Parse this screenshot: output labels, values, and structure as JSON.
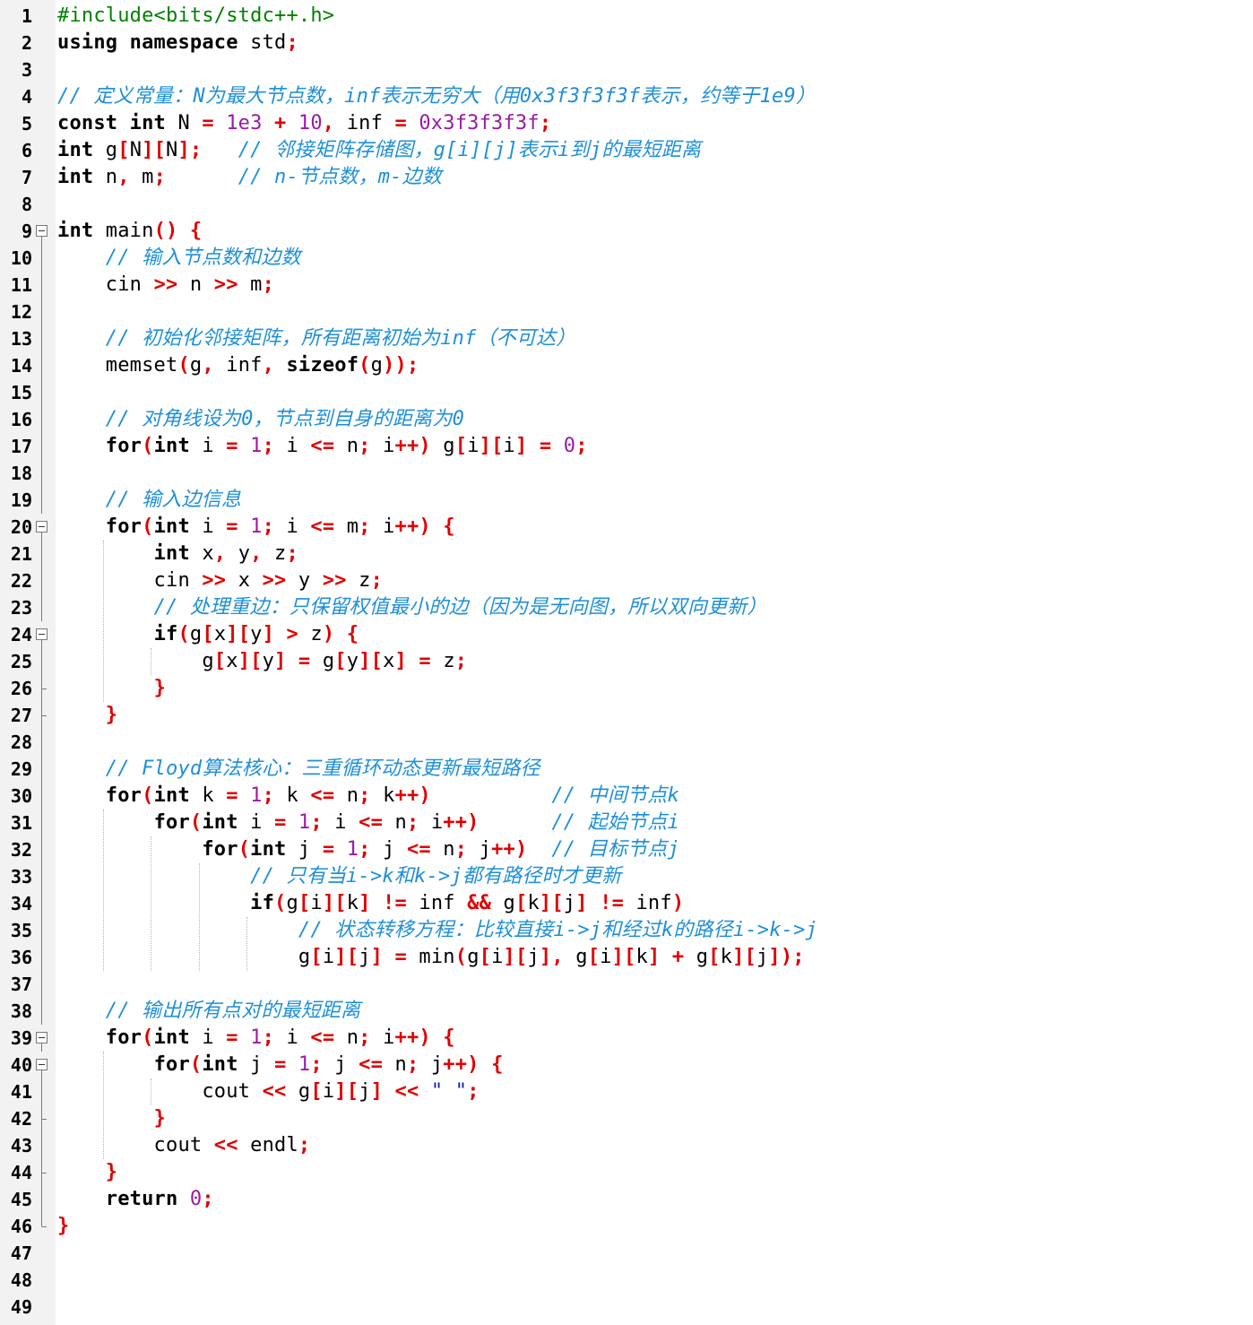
{
  "editor": {
    "line_numbers": [
      "1",
      "2",
      "3",
      "4",
      "5",
      "6",
      "7",
      "8",
      "9",
      "10",
      "11",
      "12",
      "13",
      "14",
      "15",
      "16",
      "17",
      "18",
      "19",
      "20",
      "21",
      "22",
      "23",
      "24",
      "25",
      "26",
      "27",
      "28",
      "29",
      "30",
      "31",
      "32",
      "33",
      "34",
      "35",
      "36",
      "37",
      "38",
      "39",
      "40",
      "41",
      "42",
      "43",
      "44",
      "45",
      "46",
      "47",
      "48",
      "49"
    ],
    "lines": [
      [
        [
          "pp",
          "#include<bits/stdc++.h>"
        ]
      ],
      [
        [
          "kw",
          "using namespace "
        ],
        [
          "id",
          "std"
        ],
        [
          "op",
          ";"
        ]
      ],
      [],
      [
        [
          "cm",
          "// 定义常量：N为最大节点数，inf表示无穷大（用0x3f3f3f3f表示，约等于1e9）"
        ]
      ],
      [
        [
          "kw",
          "const int "
        ],
        [
          "id",
          "N "
        ],
        [
          "op",
          "= "
        ],
        [
          "num",
          "1e3 "
        ],
        [
          "op",
          "+ "
        ],
        [
          "num",
          "10"
        ],
        [
          "op",
          ", "
        ],
        [
          "id",
          "inf "
        ],
        [
          "op",
          "= "
        ],
        [
          "num",
          "0x3f3f3f3f"
        ],
        [
          "op",
          ";"
        ]
      ],
      [
        [
          "kw",
          "int "
        ],
        [
          "id",
          "g"
        ],
        [
          "op",
          "["
        ],
        [
          "id",
          "N"
        ],
        [
          "op",
          "]["
        ],
        [
          "id",
          "N"
        ],
        [
          "op",
          "]; "
        ],
        [
          "id",
          "  "
        ],
        [
          "cm",
          "// 邻接矩阵存储图，g[i][j]表示i到j的最短距离"
        ]
      ],
      [
        [
          "kw",
          "int "
        ],
        [
          "id",
          "n"
        ],
        [
          "op",
          ", "
        ],
        [
          "id",
          "m"
        ],
        [
          "op",
          ";"
        ],
        [
          "id",
          "      "
        ],
        [
          "cm",
          "// n-节点数，m-边数"
        ]
      ],
      [],
      [
        [
          "kw",
          "int "
        ],
        [
          "id",
          "main"
        ],
        [
          "op",
          "() {"
        ]
      ],
      [
        [
          "id",
          "    "
        ],
        [
          "cm",
          "// 输入节点数和边数"
        ]
      ],
      [
        [
          "id",
          "    cin "
        ],
        [
          "op",
          ">> "
        ],
        [
          "id",
          "n "
        ],
        [
          "op",
          ">> "
        ],
        [
          "id",
          "m"
        ],
        [
          "op",
          ";"
        ]
      ],
      [],
      [
        [
          "id",
          "    "
        ],
        [
          "cm",
          "// 初始化邻接矩阵，所有距离初始为inf（不可达）"
        ]
      ],
      [
        [
          "id",
          "    memset"
        ],
        [
          "op",
          "("
        ],
        [
          "id",
          "g"
        ],
        [
          "op",
          ", "
        ],
        [
          "id",
          "inf"
        ],
        [
          "op",
          ", "
        ],
        [
          "kw",
          "sizeof"
        ],
        [
          "op",
          "("
        ],
        [
          "id",
          "g"
        ],
        [
          "op",
          "));"
        ]
      ],
      [],
      [
        [
          "id",
          "    "
        ],
        [
          "cm",
          "// 对角线设为0，节点到自身的距离为0"
        ]
      ],
      [
        [
          "id",
          "    "
        ],
        [
          "kw",
          "for"
        ],
        [
          "op",
          "("
        ],
        [
          "kw",
          "int "
        ],
        [
          "id",
          "i "
        ],
        [
          "op",
          "= "
        ],
        [
          "num",
          "1"
        ],
        [
          "op",
          "; "
        ],
        [
          "id",
          "i "
        ],
        [
          "op",
          "<= "
        ],
        [
          "id",
          "n"
        ],
        [
          "op",
          "; "
        ],
        [
          "id",
          "i"
        ],
        [
          "op",
          "++) "
        ],
        [
          "id",
          "g"
        ],
        [
          "op",
          "["
        ],
        [
          "id",
          "i"
        ],
        [
          "op",
          "]["
        ],
        [
          "id",
          "i"
        ],
        [
          "op",
          "] = "
        ],
        [
          "num",
          "0"
        ],
        [
          "op",
          ";"
        ]
      ],
      [],
      [
        [
          "id",
          "    "
        ],
        [
          "cm",
          "// 输入边信息"
        ]
      ],
      [
        [
          "id",
          "    "
        ],
        [
          "kw",
          "for"
        ],
        [
          "op",
          "("
        ],
        [
          "kw",
          "int "
        ],
        [
          "id",
          "i "
        ],
        [
          "op",
          "= "
        ],
        [
          "num",
          "1"
        ],
        [
          "op",
          "; "
        ],
        [
          "id",
          "i "
        ],
        [
          "op",
          "<= "
        ],
        [
          "id",
          "m"
        ],
        [
          "op",
          "; "
        ],
        [
          "id",
          "i"
        ],
        [
          "op",
          "++) {"
        ]
      ],
      [
        [
          "id",
          "        "
        ],
        [
          "kw",
          "int "
        ],
        [
          "id",
          "x"
        ],
        [
          "op",
          ", "
        ],
        [
          "id",
          "y"
        ],
        [
          "op",
          ", "
        ],
        [
          "id",
          "z"
        ],
        [
          "op",
          ";"
        ]
      ],
      [
        [
          "id",
          "        cin "
        ],
        [
          "op",
          ">> "
        ],
        [
          "id",
          "x "
        ],
        [
          "op",
          ">> "
        ],
        [
          "id",
          "y "
        ],
        [
          "op",
          ">> "
        ],
        [
          "id",
          "z"
        ],
        [
          "op",
          ";"
        ]
      ],
      [
        [
          "id",
          "        "
        ],
        [
          "cm",
          "// 处理重边：只保留权值最小的边（因为是无向图，所以双向更新）"
        ]
      ],
      [
        [
          "id",
          "        "
        ],
        [
          "kw",
          "if"
        ],
        [
          "op",
          "("
        ],
        [
          "id",
          "g"
        ],
        [
          "op",
          "["
        ],
        [
          "id",
          "x"
        ],
        [
          "op",
          "]["
        ],
        [
          "id",
          "y"
        ],
        [
          "op",
          "] > "
        ],
        [
          "id",
          "z"
        ],
        [
          "op",
          ") {"
        ]
      ],
      [
        [
          "id",
          "            g"
        ],
        [
          "op",
          "["
        ],
        [
          "id",
          "x"
        ],
        [
          "op",
          "]["
        ],
        [
          "id",
          "y"
        ],
        [
          "op",
          "] = "
        ],
        [
          "id",
          "g"
        ],
        [
          "op",
          "["
        ],
        [
          "id",
          "y"
        ],
        [
          "op",
          "]["
        ],
        [
          "id",
          "x"
        ],
        [
          "op",
          "] = "
        ],
        [
          "id",
          "z"
        ],
        [
          "op",
          ";"
        ]
      ],
      [
        [
          "id",
          "        "
        ],
        [
          "op",
          "}"
        ]
      ],
      [
        [
          "id",
          "    "
        ],
        [
          "op",
          "}"
        ]
      ],
      [],
      [
        [
          "id",
          "    "
        ],
        [
          "cm",
          "// Floyd算法核心：三重循环动态更新最短路径"
        ]
      ],
      [
        [
          "id",
          "    "
        ],
        [
          "kw",
          "for"
        ],
        [
          "op",
          "("
        ],
        [
          "kw",
          "int "
        ],
        [
          "id",
          "k "
        ],
        [
          "op",
          "= "
        ],
        [
          "num",
          "1"
        ],
        [
          "op",
          "; "
        ],
        [
          "id",
          "k "
        ],
        [
          "op",
          "<= "
        ],
        [
          "id",
          "n"
        ],
        [
          "op",
          "; "
        ],
        [
          "id",
          "k"
        ],
        [
          "op",
          "++)"
        ],
        [
          "id",
          "          "
        ],
        [
          "cm",
          "// 中间节点k"
        ]
      ],
      [
        [
          "id",
          "        "
        ],
        [
          "kw",
          "for"
        ],
        [
          "op",
          "("
        ],
        [
          "kw",
          "int "
        ],
        [
          "id",
          "i "
        ],
        [
          "op",
          "= "
        ],
        [
          "num",
          "1"
        ],
        [
          "op",
          "; "
        ],
        [
          "id",
          "i "
        ],
        [
          "op",
          "<= "
        ],
        [
          "id",
          "n"
        ],
        [
          "op",
          "; "
        ],
        [
          "id",
          "i"
        ],
        [
          "op",
          "++)"
        ],
        [
          "id",
          "      "
        ],
        [
          "cm",
          "// 起始节点i"
        ]
      ],
      [
        [
          "id",
          "            "
        ],
        [
          "kw",
          "for"
        ],
        [
          "op",
          "("
        ],
        [
          "kw",
          "int "
        ],
        [
          "id",
          "j "
        ],
        [
          "op",
          "= "
        ],
        [
          "num",
          "1"
        ],
        [
          "op",
          "; "
        ],
        [
          "id",
          "j "
        ],
        [
          "op",
          "<= "
        ],
        [
          "id",
          "n"
        ],
        [
          "op",
          "; "
        ],
        [
          "id",
          "j"
        ],
        [
          "op",
          "++)"
        ],
        [
          "id",
          "  "
        ],
        [
          "cm",
          "// 目标节点j"
        ]
      ],
      [
        [
          "id",
          "                "
        ],
        [
          "cm",
          "// 只有当i->k和k->j都有路径时才更新"
        ]
      ],
      [
        [
          "id",
          "                "
        ],
        [
          "kw",
          "if"
        ],
        [
          "op",
          "("
        ],
        [
          "id",
          "g"
        ],
        [
          "op",
          "["
        ],
        [
          "id",
          "i"
        ],
        [
          "op",
          "]["
        ],
        [
          "id",
          "k"
        ],
        [
          "op",
          "] != "
        ],
        [
          "id",
          "inf "
        ],
        [
          "op",
          "&& "
        ],
        [
          "id",
          "g"
        ],
        [
          "op",
          "["
        ],
        [
          "id",
          "k"
        ],
        [
          "op",
          "]["
        ],
        [
          "id",
          "j"
        ],
        [
          "op",
          "] != "
        ],
        [
          "id",
          "inf"
        ],
        [
          "op",
          ")"
        ]
      ],
      [
        [
          "id",
          "                    "
        ],
        [
          "cm",
          "// 状态转移方程：比较直接i->j和经过k的路径i->k->j"
        ]
      ],
      [
        [
          "id",
          "                    g"
        ],
        [
          "op",
          "["
        ],
        [
          "id",
          "i"
        ],
        [
          "op",
          "]["
        ],
        [
          "id",
          "j"
        ],
        [
          "op",
          "] = "
        ],
        [
          "id",
          "min"
        ],
        [
          "op",
          "("
        ],
        [
          "id",
          "g"
        ],
        [
          "op",
          "["
        ],
        [
          "id",
          "i"
        ],
        [
          "op",
          "]["
        ],
        [
          "id",
          "j"
        ],
        [
          "op",
          "], "
        ],
        [
          "id",
          "g"
        ],
        [
          "op",
          "["
        ],
        [
          "id",
          "i"
        ],
        [
          "op",
          "]["
        ],
        [
          "id",
          "k"
        ],
        [
          "op",
          "] + "
        ],
        [
          "id",
          "g"
        ],
        [
          "op",
          "["
        ],
        [
          "id",
          "k"
        ],
        [
          "op",
          "]["
        ],
        [
          "id",
          "j"
        ],
        [
          "op",
          "]);"
        ]
      ],
      [],
      [
        [
          "id",
          "    "
        ],
        [
          "cm",
          "// 输出所有点对的最短距离"
        ]
      ],
      [
        [
          "id",
          "    "
        ],
        [
          "kw",
          "for"
        ],
        [
          "op",
          "("
        ],
        [
          "kw",
          "int "
        ],
        [
          "id",
          "i "
        ],
        [
          "op",
          "= "
        ],
        [
          "num",
          "1"
        ],
        [
          "op",
          "; "
        ],
        [
          "id",
          "i "
        ],
        [
          "op",
          "<= "
        ],
        [
          "id",
          "n"
        ],
        [
          "op",
          "; "
        ],
        [
          "id",
          "i"
        ],
        [
          "op",
          "++) {"
        ]
      ],
      [
        [
          "id",
          "        "
        ],
        [
          "kw",
          "for"
        ],
        [
          "op",
          "("
        ],
        [
          "kw",
          "int "
        ],
        [
          "id",
          "j "
        ],
        [
          "op",
          "= "
        ],
        [
          "num",
          "1"
        ],
        [
          "op",
          "; "
        ],
        [
          "id",
          "j "
        ],
        [
          "op",
          "<= "
        ],
        [
          "id",
          "n"
        ],
        [
          "op",
          "; "
        ],
        [
          "id",
          "j"
        ],
        [
          "op",
          "++) {"
        ]
      ],
      [
        [
          "id",
          "            cout "
        ],
        [
          "op",
          "<< "
        ],
        [
          "id",
          "g"
        ],
        [
          "op",
          "["
        ],
        [
          "id",
          "i"
        ],
        [
          "op",
          "]["
        ],
        [
          "id",
          "j"
        ],
        [
          "op",
          "] << "
        ],
        [
          "str",
          "\" \""
        ],
        [
          "op",
          ";"
        ]
      ],
      [
        [
          "id",
          "        "
        ],
        [
          "op",
          "}"
        ]
      ],
      [
        [
          "id",
          "        cout "
        ],
        [
          "op",
          "<< "
        ],
        [
          "id",
          "endl"
        ],
        [
          "op",
          ";"
        ]
      ],
      [
        [
          "id",
          "    "
        ],
        [
          "op",
          "}"
        ]
      ],
      [
        [
          "id",
          "    "
        ],
        [
          "kw",
          "return "
        ],
        [
          "num",
          "0"
        ],
        [
          "op",
          ";"
        ]
      ],
      [
        [
          "op",
          "}"
        ]
      ],
      [],
      [],
      []
    ],
    "folds": {
      "9": "open",
      "20": "open",
      "24": "open",
      "39": "open",
      "40": "open",
      "26": "end",
      "27": "end",
      "42": "end",
      "44": "end",
      "46": "last"
    },
    "colors": {
      "background": "#ffffff",
      "gutter": "#f2f2f2",
      "keyword": "#000000",
      "operator": "#e00000",
      "number": "#9a1aa8",
      "preprocessor": "#008000",
      "comment": "#1e8fd8",
      "string": "#1a1aa6"
    }
  }
}
